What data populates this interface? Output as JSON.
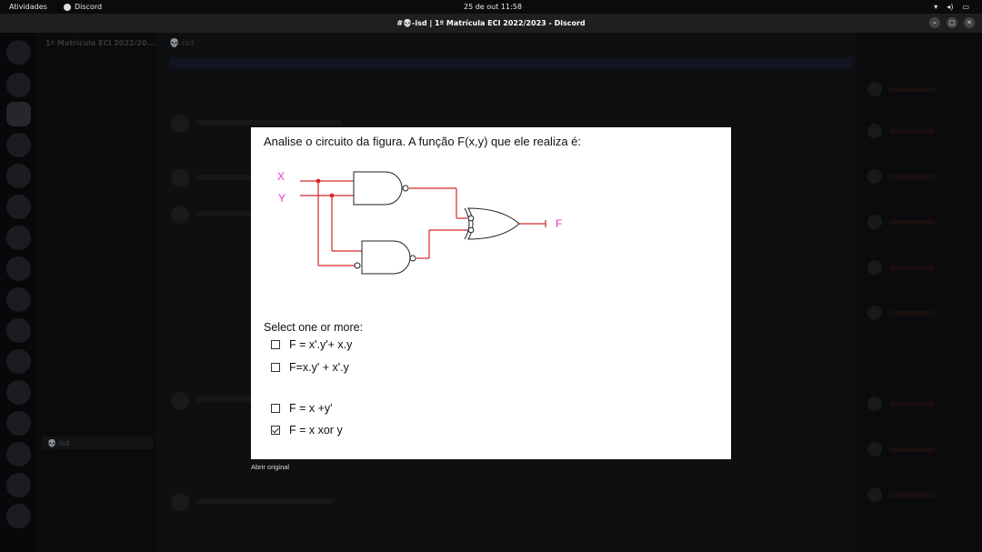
{
  "topbar": {
    "activities": "Atividades",
    "app_name": "Discord",
    "clock": "25 de out  11:58"
  },
  "window": {
    "title": "#💀-isd | 1º Matrícula ECI 2022/2023 - Discord"
  },
  "background": {
    "server_name": "1º Matrícula ECI 2022/20...",
    "channel_header": "💀-isd",
    "selected_channel": "💀-isd"
  },
  "modal": {
    "question": "Analise o circuito da figura. A função F(x,y) que ele realiza é:",
    "select_label": "Select one or more:",
    "options": [
      {
        "label": "F = x'.y'+ x.y",
        "checked": false
      },
      {
        "label": "F=x.y' + x'.y",
        "checked": false
      },
      {
        "label": "F = x +y'",
        "checked": false
      },
      {
        "label": "F = x xor y",
        "checked": true
      }
    ],
    "circuit": {
      "input_x": "X",
      "input_y": "Y",
      "output": "F",
      "label_color": "#e832c9",
      "wire_color": "#d6282c"
    }
  },
  "open_original": "Abrir original"
}
